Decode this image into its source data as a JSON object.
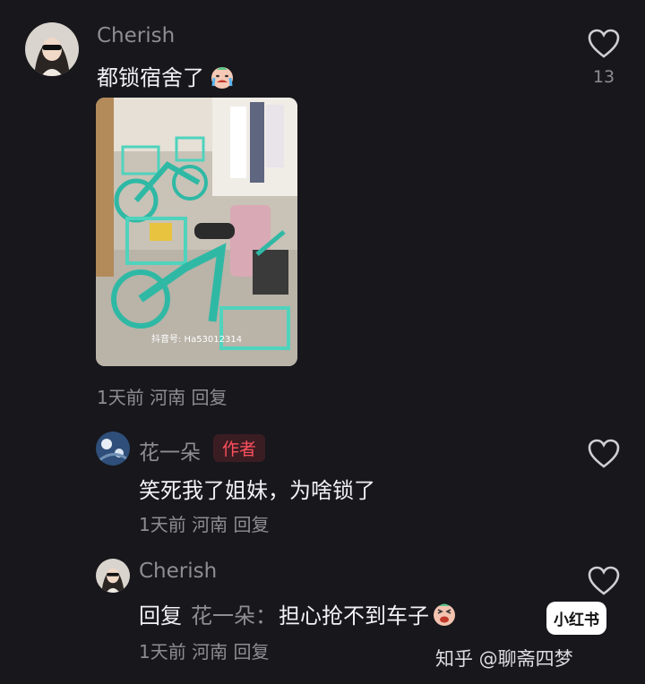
{
  "comment1": {
    "username": "Cherish",
    "text": "都锁宿舍了",
    "emoji_icon": "crying-face-icon",
    "likes": "13",
    "meta": "1天前 河南 回复",
    "photo_caption": "抖音号: Ha53012314"
  },
  "comment2": {
    "username": "花一朵",
    "badge": "作者",
    "text": "笑死我了姐妹，为啥锁了",
    "meta": "1天前 河南 回复"
  },
  "comment3": {
    "username": "Cherish",
    "reply_prefix": "回复",
    "reply_to": "花一朵：",
    "text": "担心抢不到车子",
    "emoji_icon": "laughing-face-icon",
    "meta": "1天前 河南 回复"
  },
  "watermark": {
    "site": "知乎 @聊斋四梦",
    "logo": "小红书"
  },
  "colors": {
    "background": "#17171c",
    "muted": "#8d8d93",
    "author_badge": "#ff4f5e",
    "bike_teal": "#2fb9a5"
  }
}
